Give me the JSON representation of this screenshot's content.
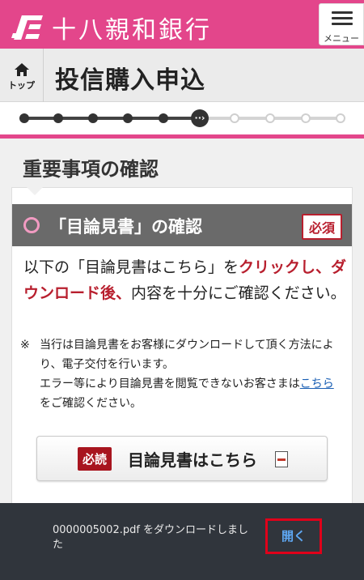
{
  "header": {
    "bank_name": "十八親和銀行",
    "menu_label": "メニュー",
    "brand_color": "#e3468b"
  },
  "titlebar": {
    "home_label": "トップ",
    "page_title": "投信購入申込"
  },
  "stepper": {
    "current_glyph": "··›",
    "steps": [
      "done",
      "done",
      "done",
      "done",
      "done",
      "current",
      "todo",
      "todo",
      "todo",
      "todo"
    ]
  },
  "content": {
    "section_heading": "重要事項の確認",
    "card": {
      "title": "「目論見書」の確認",
      "required_badge": "必須",
      "instruction_pre": "以下の「目論見書はこちら」を",
      "instruction_red": "クリックし、ダウンロード後、",
      "instruction_post": "内容を十分にご確認ください。",
      "note_mark": "※",
      "note_text": "当行は目論見書をお客様にダウンロードして頂く方法により、電子交付を行います。",
      "note_text2": "エラー等により目論見書を閲覧できないお客さまは",
      "note_link": "こちら",
      "note_text3": "をご確認ください。",
      "doc_button_tag": "必読",
      "doc_button_label": "目論見書はこちら"
    }
  },
  "toast": {
    "message": "0000005002.pdf をダウンロードしました",
    "action_label": "開く"
  }
}
